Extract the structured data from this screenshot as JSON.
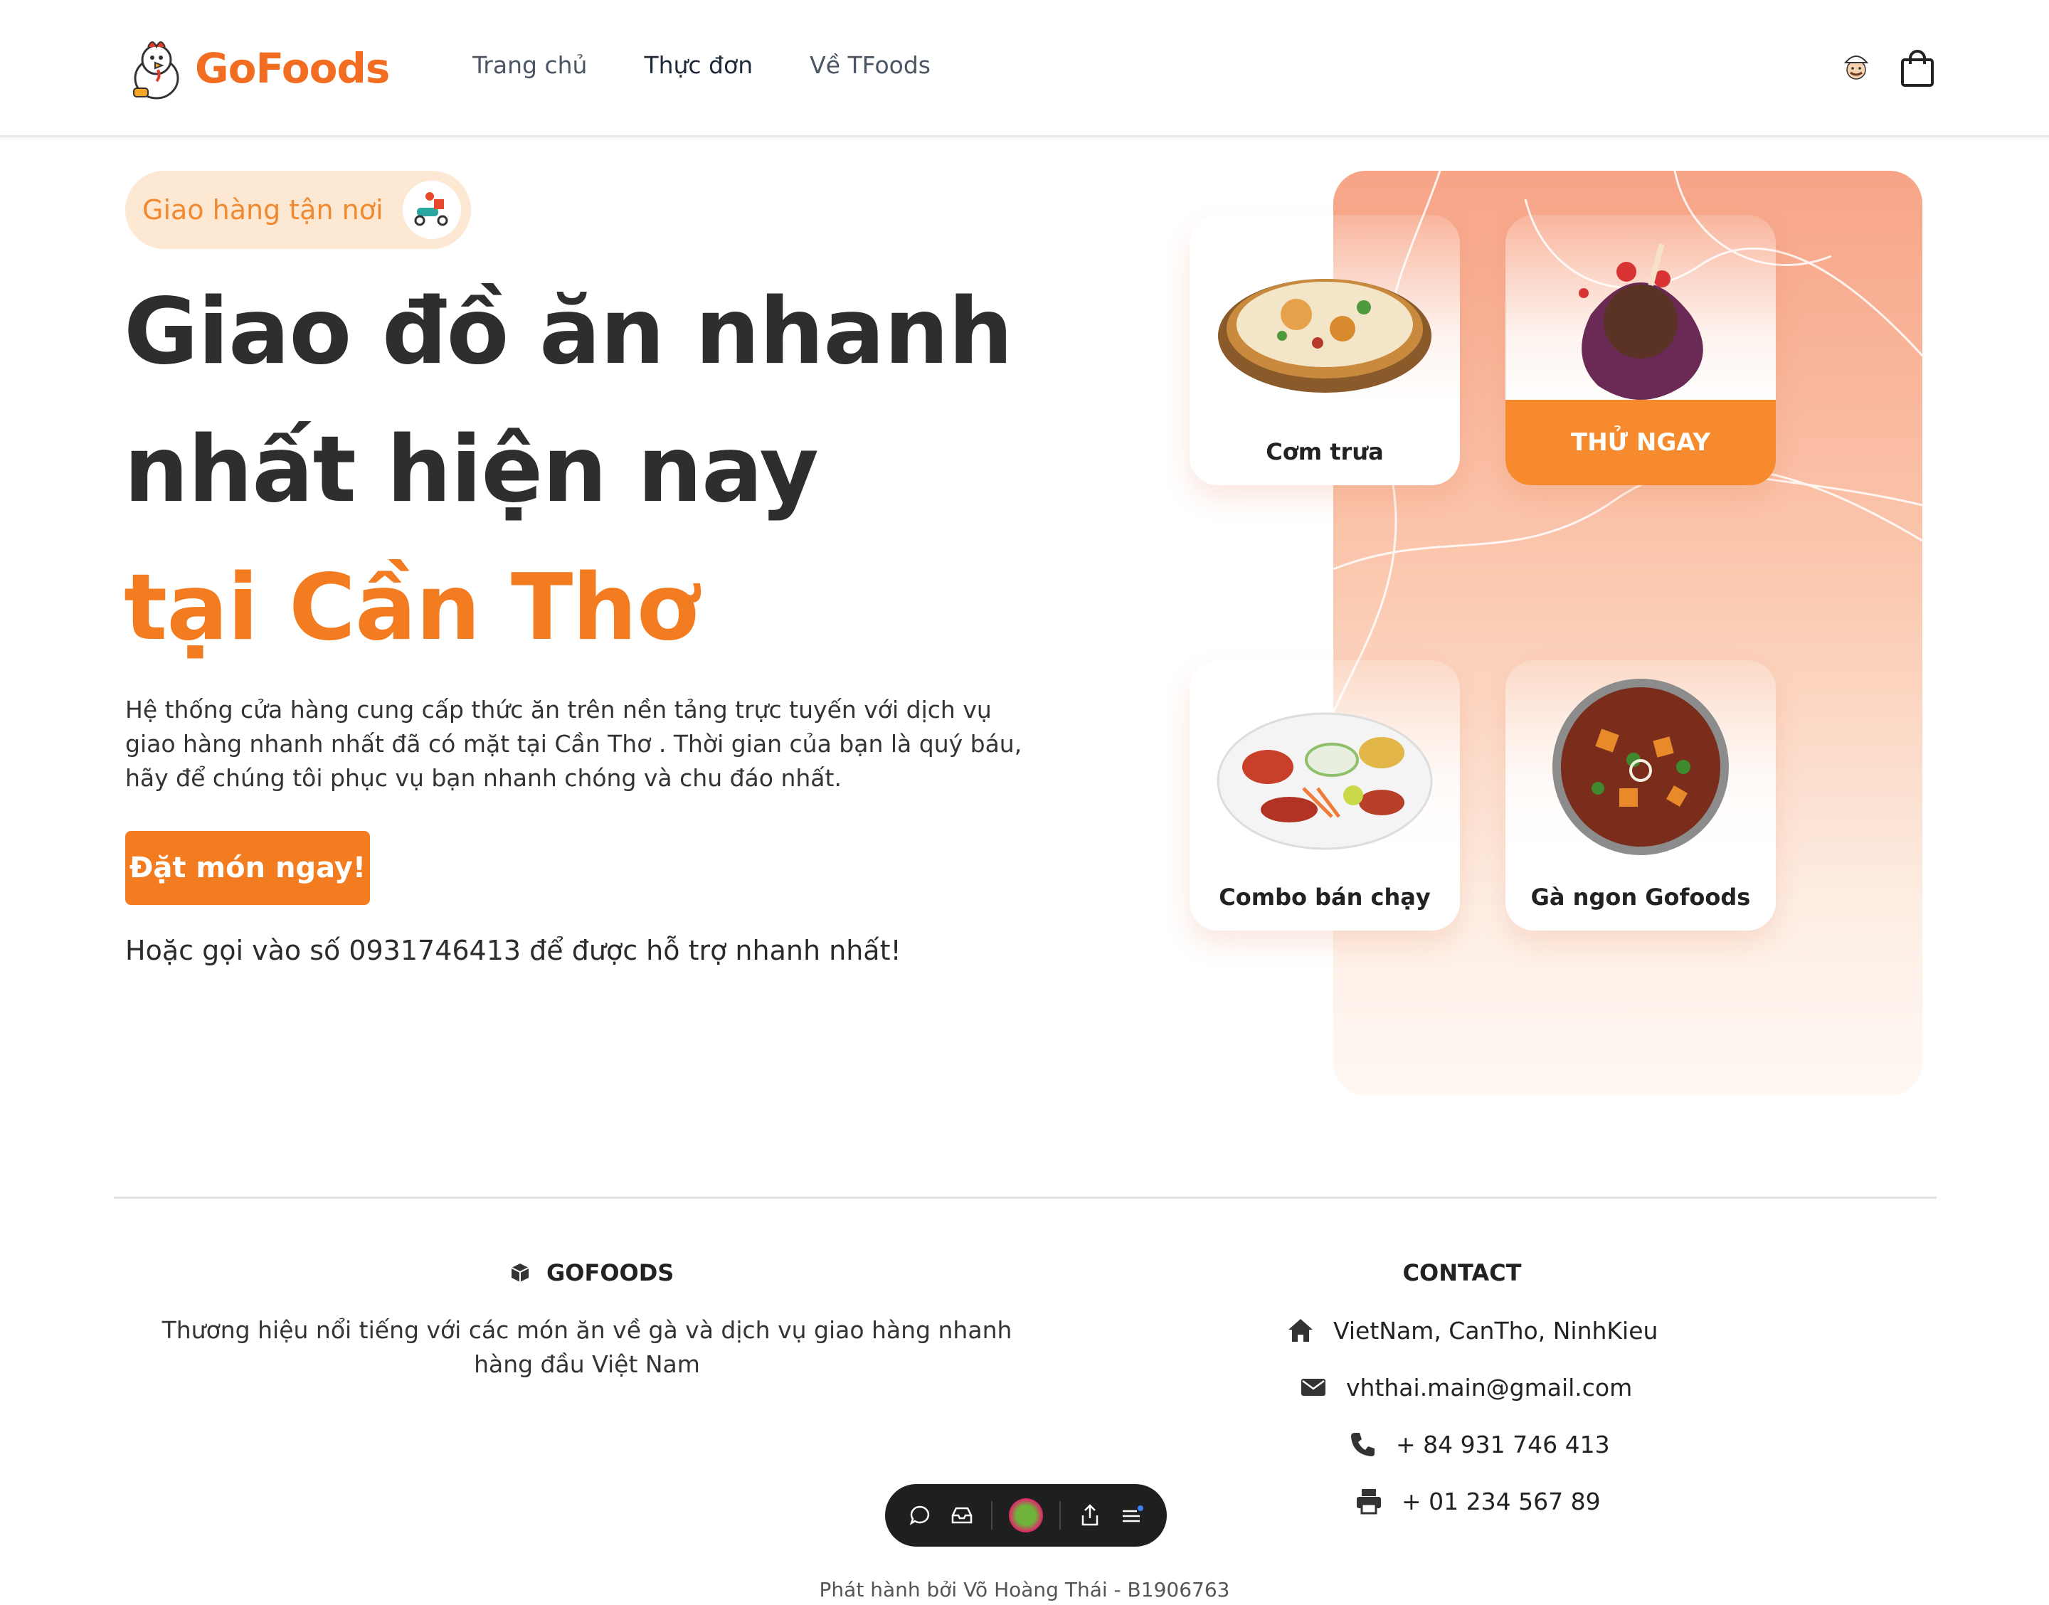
{
  "header": {
    "brand": "GoFoods",
    "nav": [
      {
        "label": "Trang chủ"
      },
      {
        "label": "Thực đơn"
      },
      {
        "label": "Về TFoods"
      }
    ]
  },
  "hero": {
    "badge": "Giao hàng tận nơi",
    "title_lines": [
      "Giao đồ ăn nhanh",
      "nhất hiện nay",
      "tại Cần Thơ"
    ],
    "description": "Hệ thống cửa hàng cung cấp thức ăn trên nền tảng trực tuyến với dịch vụ giao hàng nhanh nhất đã có mặt tại Cần Thơ . Thời gian của bạn là quý báu, hãy để chúng tôi phục vụ bạn nhanh chóng và chu đáo nhất.",
    "cta": "Đặt món ngay!",
    "hotline": "Hoặc gọi vào số 0931746413 để được hỗ trợ nhanh nhất!"
  },
  "cards": [
    {
      "label": "Cơm trưa"
    },
    {
      "label": "THỬ NGAY"
    },
    {
      "label": "Combo bán chạy"
    },
    {
      "label": "Gà ngon Gofoods"
    }
  ],
  "footer": {
    "brand_title": "GOFOODS",
    "brand_desc": "Thương hiệu nổi tiếng với các món ăn về gà và dịch vụ giao hàng nhanh hàng đầu Việt Nam",
    "contact_title": "CONTACT",
    "address": "VietNam, CanTho, NinhKieu",
    "email": "vhthai.main@gmail.com",
    "phone": "+ 84 931 746 413",
    "fax": "+ 01 234 567 89",
    "credit": "Phát hành bởi Võ Hoàng Thái - B1906763"
  },
  "colors": {
    "accent": "#f47c20",
    "badge_bg": "#fde8d4",
    "panel_top": "#f7a487",
    "text_dark": "#2e2e2e"
  },
  "icons": [
    "chicken-mascot-logo",
    "chef-avatar-icon",
    "shopping-bag-icon",
    "delivery-scooter-icon",
    "cube-icon",
    "home-icon",
    "envelope-icon",
    "phone-icon",
    "printer-icon",
    "chat-icon",
    "inbox-icon",
    "share-icon",
    "menu-icon"
  ]
}
